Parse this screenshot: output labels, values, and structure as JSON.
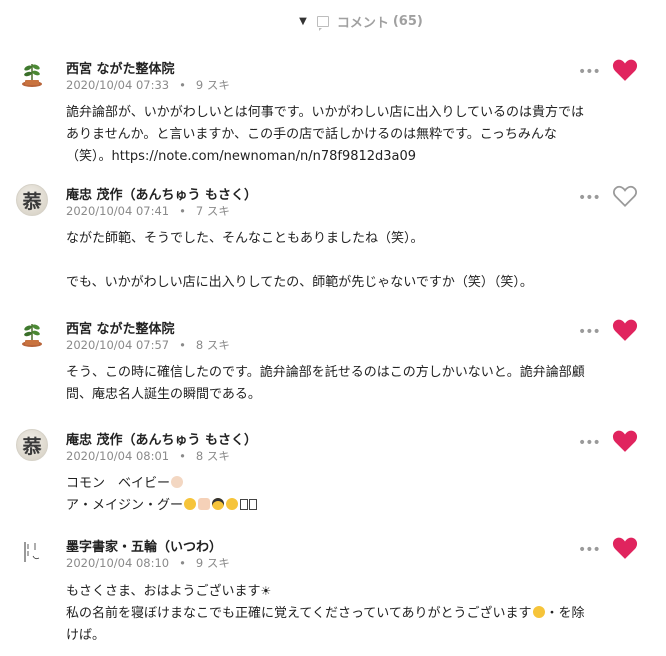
{
  "header": {
    "label": "コメント",
    "count": "(65)"
  },
  "comments": [
    {
      "author": "西宮 ながた整体院",
      "date": "2020/10/04 07:33",
      "likes": "9 スキ",
      "liked": true,
      "avatar": "plant",
      "lines": [
        "詭弁論部が、いかがわしいとは何事です。いかがわしい店に出入りしているのは貴方では",
        "ありませんか。と言いますか、この手の店で話しかけるのは無粋です。こっちみんな",
        "（笑）。https://note.com/newnoman/n/n78f9812d3a09"
      ]
    },
    {
      "author": "庵忠 茂作（あんちゅう もさく）",
      "date": "2020/10/04 07:41",
      "likes": "7 スキ",
      "liked": false,
      "avatar": "char",
      "avatar_char": "菾",
      "lines": [
        "ながた師範、そうでした、そんなこともありましたね（笑）。",
        "でも、いかがわしい店に出入りしてたの、師範が先じゃないですか（笑）（笑）。"
      ]
    },
    {
      "author": "西宮 ながた整体院",
      "date": "2020/10/04 07:57",
      "likes": "8 スキ",
      "liked": true,
      "avatar": "plant",
      "lines": [
        "そう、この時に確信したのです。詭弁論部を託せるのはこの方しかいないと。詭弁論部顧",
        "問、庵忠名人誕生の瞬間である。"
      ]
    },
    {
      "author": "庵忠 茂作（あんちゅう もさく）",
      "date": "2020/10/04 08:01",
      "likes": "8 スキ",
      "liked": true,
      "avatar": "char",
      "avatar_char": "菾",
      "lines": [
        "コモン　ベイビー",
        "ア・メイジン・グー"
      ]
    },
    {
      "author": "墨字書家・五輪（いつわ）",
      "date": "2020/10/04 08:10",
      "likes": "9 スキ",
      "liked": true,
      "avatar": "text",
      "lines": [
        "もさくさま、おはようございます",
        "私の名前を寝ぼけまなこでも正確に覚えてくださっていてありがとうございます",
        "けば。"
      ],
      "line2_tail": "・を除"
    }
  ],
  "icons": {
    "collapse": "caret-down-icon",
    "comment": "comment-icon",
    "more": "more-dots-icon",
    "heart_filled": "heart-filled-icon",
    "heart_outline": "heart-outline-icon"
  },
  "colors": {
    "heart": "#e0245e",
    "heart_outline": "#9a9a9a",
    "meta": "#8a8a8a"
  }
}
